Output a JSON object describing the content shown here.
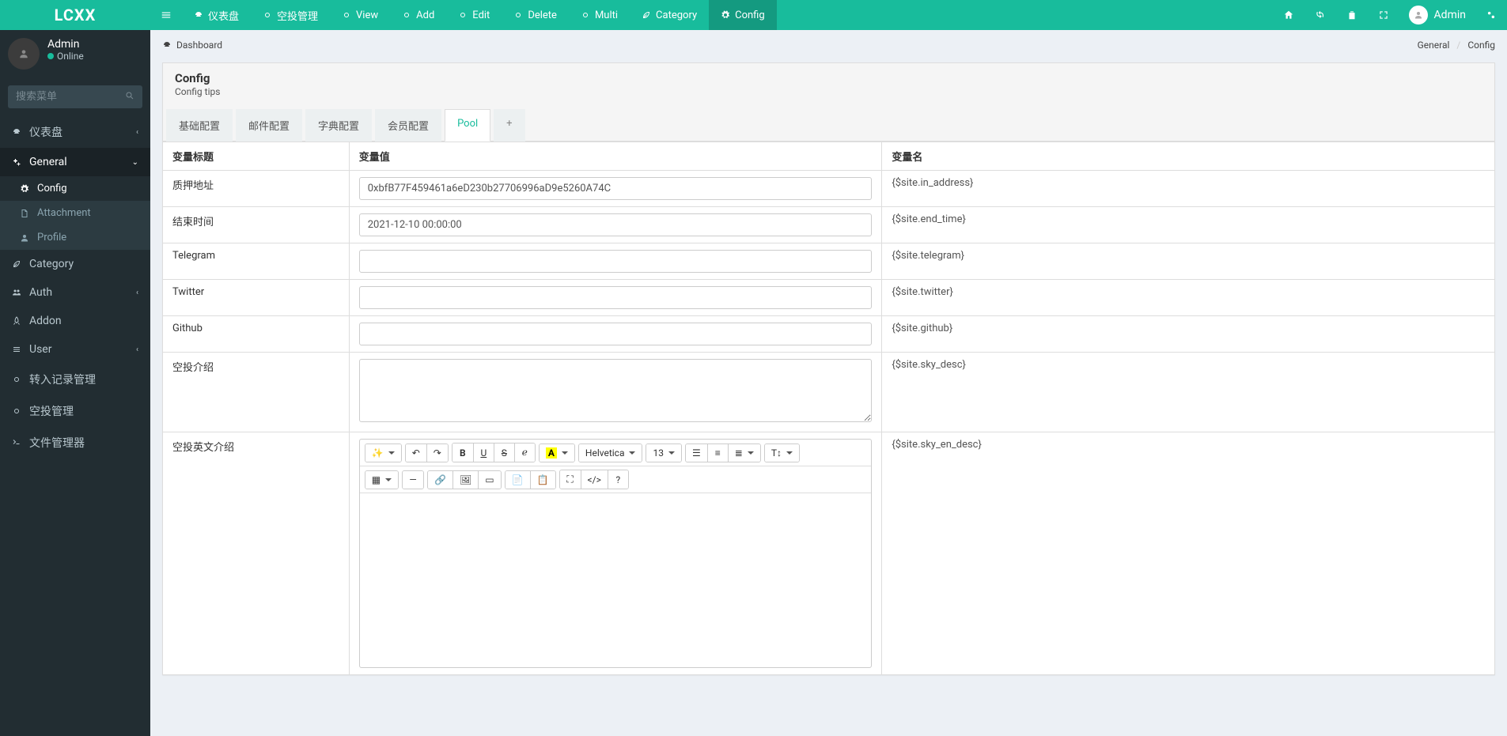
{
  "brand": "LCXX",
  "header": {
    "toggle": "≡",
    "tabs": [
      {
        "icon": "dashboard-icon",
        "name": "dashboard-tab",
        "label": "仪表盘"
      },
      {
        "icon": "circle-icon",
        "name": "airdrop-tab",
        "label": "空投管理"
      },
      {
        "icon": "circle-icon",
        "name": "view-tab",
        "label": "View"
      },
      {
        "icon": "circle-icon",
        "name": "add-tab",
        "label": "Add"
      },
      {
        "icon": "circle-icon",
        "name": "edit-tab",
        "label": "Edit"
      },
      {
        "icon": "circle-icon",
        "name": "delete-tab",
        "label": "Delete"
      },
      {
        "icon": "circle-icon",
        "name": "multi-tab",
        "label": "Multi"
      },
      {
        "icon": "leaf-icon",
        "name": "category-tab",
        "label": "Category"
      },
      {
        "icon": "gear-icon",
        "name": "config-tab",
        "label": "Config",
        "active": true
      }
    ],
    "right_user": "Admin"
  },
  "sidebar": {
    "user": {
      "name": "Admin",
      "status": "Online"
    },
    "search_placeholder": "搜索菜单",
    "items": [
      {
        "icon": "dashboard-icon",
        "label": "仪表盘",
        "name": "sidebar-dashboard",
        "arrow": true
      },
      {
        "icon": "cogs-icon",
        "label": "General",
        "name": "sidebar-general",
        "arrow_down": true,
        "open": true,
        "children": [
          {
            "icon": "gear-icon",
            "label": "Config",
            "name": "sidebar-config",
            "active": true
          },
          {
            "icon": "file-icon",
            "label": "Attachment",
            "name": "sidebar-attachment"
          },
          {
            "icon": "user-icon",
            "label": "Profile",
            "name": "sidebar-profile"
          }
        ]
      },
      {
        "icon": "leaf-icon",
        "label": "Category",
        "name": "sidebar-category"
      },
      {
        "icon": "group-icon",
        "label": "Auth",
        "name": "sidebar-auth",
        "arrow": true
      },
      {
        "icon": "rocket-icon",
        "label": "Addon",
        "name": "sidebar-addon"
      },
      {
        "icon": "list-icon",
        "label": "User",
        "name": "sidebar-user",
        "arrow": true
      },
      {
        "icon": "circle-icon",
        "label": "转入记录管理",
        "name": "sidebar-transfer"
      },
      {
        "icon": "circle-icon",
        "label": "空投管理",
        "name": "sidebar-airdrop"
      },
      {
        "icon": "terminal-icon",
        "label": "文件管理器",
        "name": "sidebar-filemgr"
      }
    ]
  },
  "breadcrumb": {
    "left_icon": "dashboard-icon",
    "left_label": "Dashboard",
    "right": [
      "General",
      "Config"
    ]
  },
  "panel": {
    "title": "Config",
    "subtitle": "Config tips",
    "tabs": [
      "基础配置",
      "邮件配置",
      "字典配置",
      "会员配置",
      "Pool"
    ],
    "active_tab_index": 4,
    "plus_tab": "+"
  },
  "table": {
    "headers": {
      "title": "变量标题",
      "value": "变量值",
      "name": "变量名"
    },
    "rows": [
      {
        "title": "质押地址",
        "type": "input",
        "value": "0xbfB77F459461a6eD230b27706996aD9e5260A74C",
        "var": "{$site.in_address}"
      },
      {
        "title": "结束时间",
        "type": "input",
        "value": "2021-12-10 00:00:00",
        "var": "{$site.end_time}"
      },
      {
        "title": "Telegram",
        "type": "input",
        "value": "",
        "var": "{$site.telegram}"
      },
      {
        "title": "Twitter",
        "type": "input",
        "value": "",
        "var": "{$site.twitter}"
      },
      {
        "title": "Github",
        "type": "input",
        "value": "",
        "var": "{$site.github}"
      },
      {
        "title": "空投介绍",
        "type": "textarea",
        "value": "",
        "var": "{$site.sky_desc}"
      },
      {
        "title": "空投英文介绍",
        "type": "editor",
        "value": "",
        "var": "{$site.sky_en_desc}"
      }
    ]
  },
  "editor": {
    "font": "Helvetica",
    "size": "13"
  }
}
